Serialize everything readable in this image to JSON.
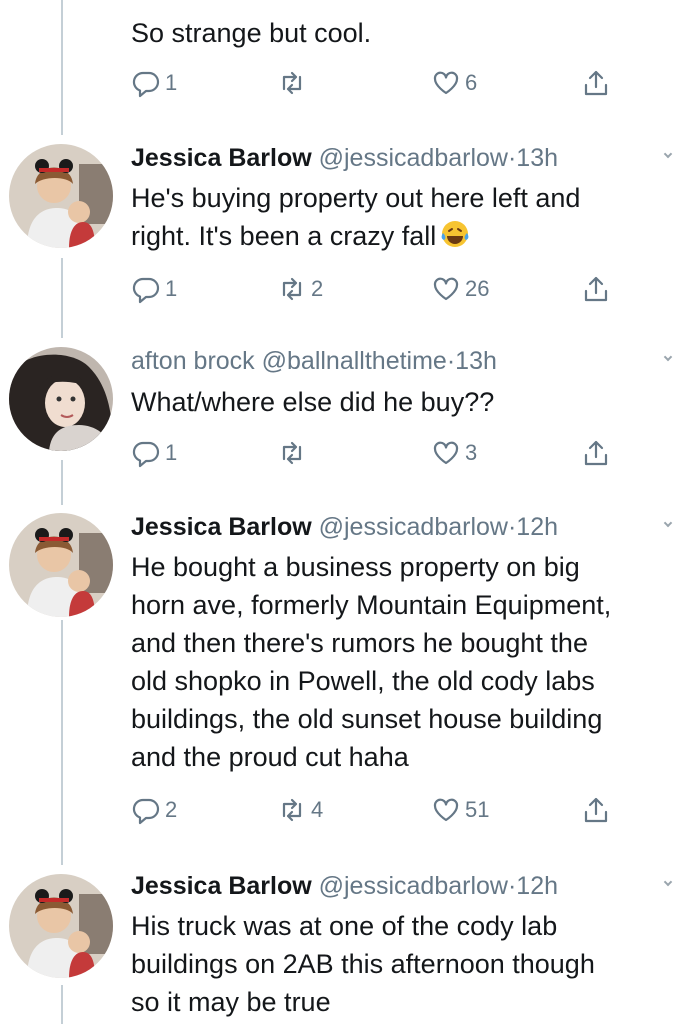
{
  "tweets": [
    {
      "name": "",
      "handle": "",
      "time": "",
      "lines": [
        "So strange but cool."
      ],
      "replies": "1",
      "retweets": "",
      "likes": "6"
    },
    {
      "name": "Jessica Barlow",
      "handle": "@jessicadbarlow",
      "time": "13h",
      "lines": [
        "He's buying property out here left and",
        "right. It's been a crazy fall"
      ],
      "replies": "1",
      "retweets": "2",
      "likes": "26",
      "emoji": "face-with-tears-of-joy-emoji"
    },
    {
      "name": "afton brock",
      "handle": "@ballnallthetime",
      "time": "13h",
      "lines": [
        "What/where else did he buy??"
      ],
      "replies": "1",
      "retweets": "",
      "likes": "3"
    },
    {
      "name": "Jessica Barlow",
      "handle": "@jessicadbarlow",
      "time": "12h",
      "lines": [
        "He bought a business property on big",
        "horn ave, formerly Mountain Equipment,",
        "and then there's rumors he bought the",
        "old shopko in Powell, the old cody labs",
        "buildings, the old sunset house building",
        "and the proud cut haha"
      ],
      "replies": "2",
      "retweets": "4",
      "likes": "51"
    },
    {
      "name": "Jessica Barlow",
      "handle": "@jessicadbarlow",
      "time": "12h",
      "lines": [
        "His truck was at one of the cody lab",
        "buildings on 2AB this afternoon though",
        "so it may be true"
      ],
      "replies": "",
      "retweets": "",
      "likes": ""
    }
  ],
  "separator": "·",
  "icons": {
    "reply": "reply-icon",
    "retweet": "retweet-icon",
    "like": "heart-icon",
    "share": "share-icon",
    "more": "chevron-down-icon"
  },
  "colors": {
    "text": "#14171a",
    "muted": "#657786",
    "thread_line": "#c4cfd6"
  }
}
